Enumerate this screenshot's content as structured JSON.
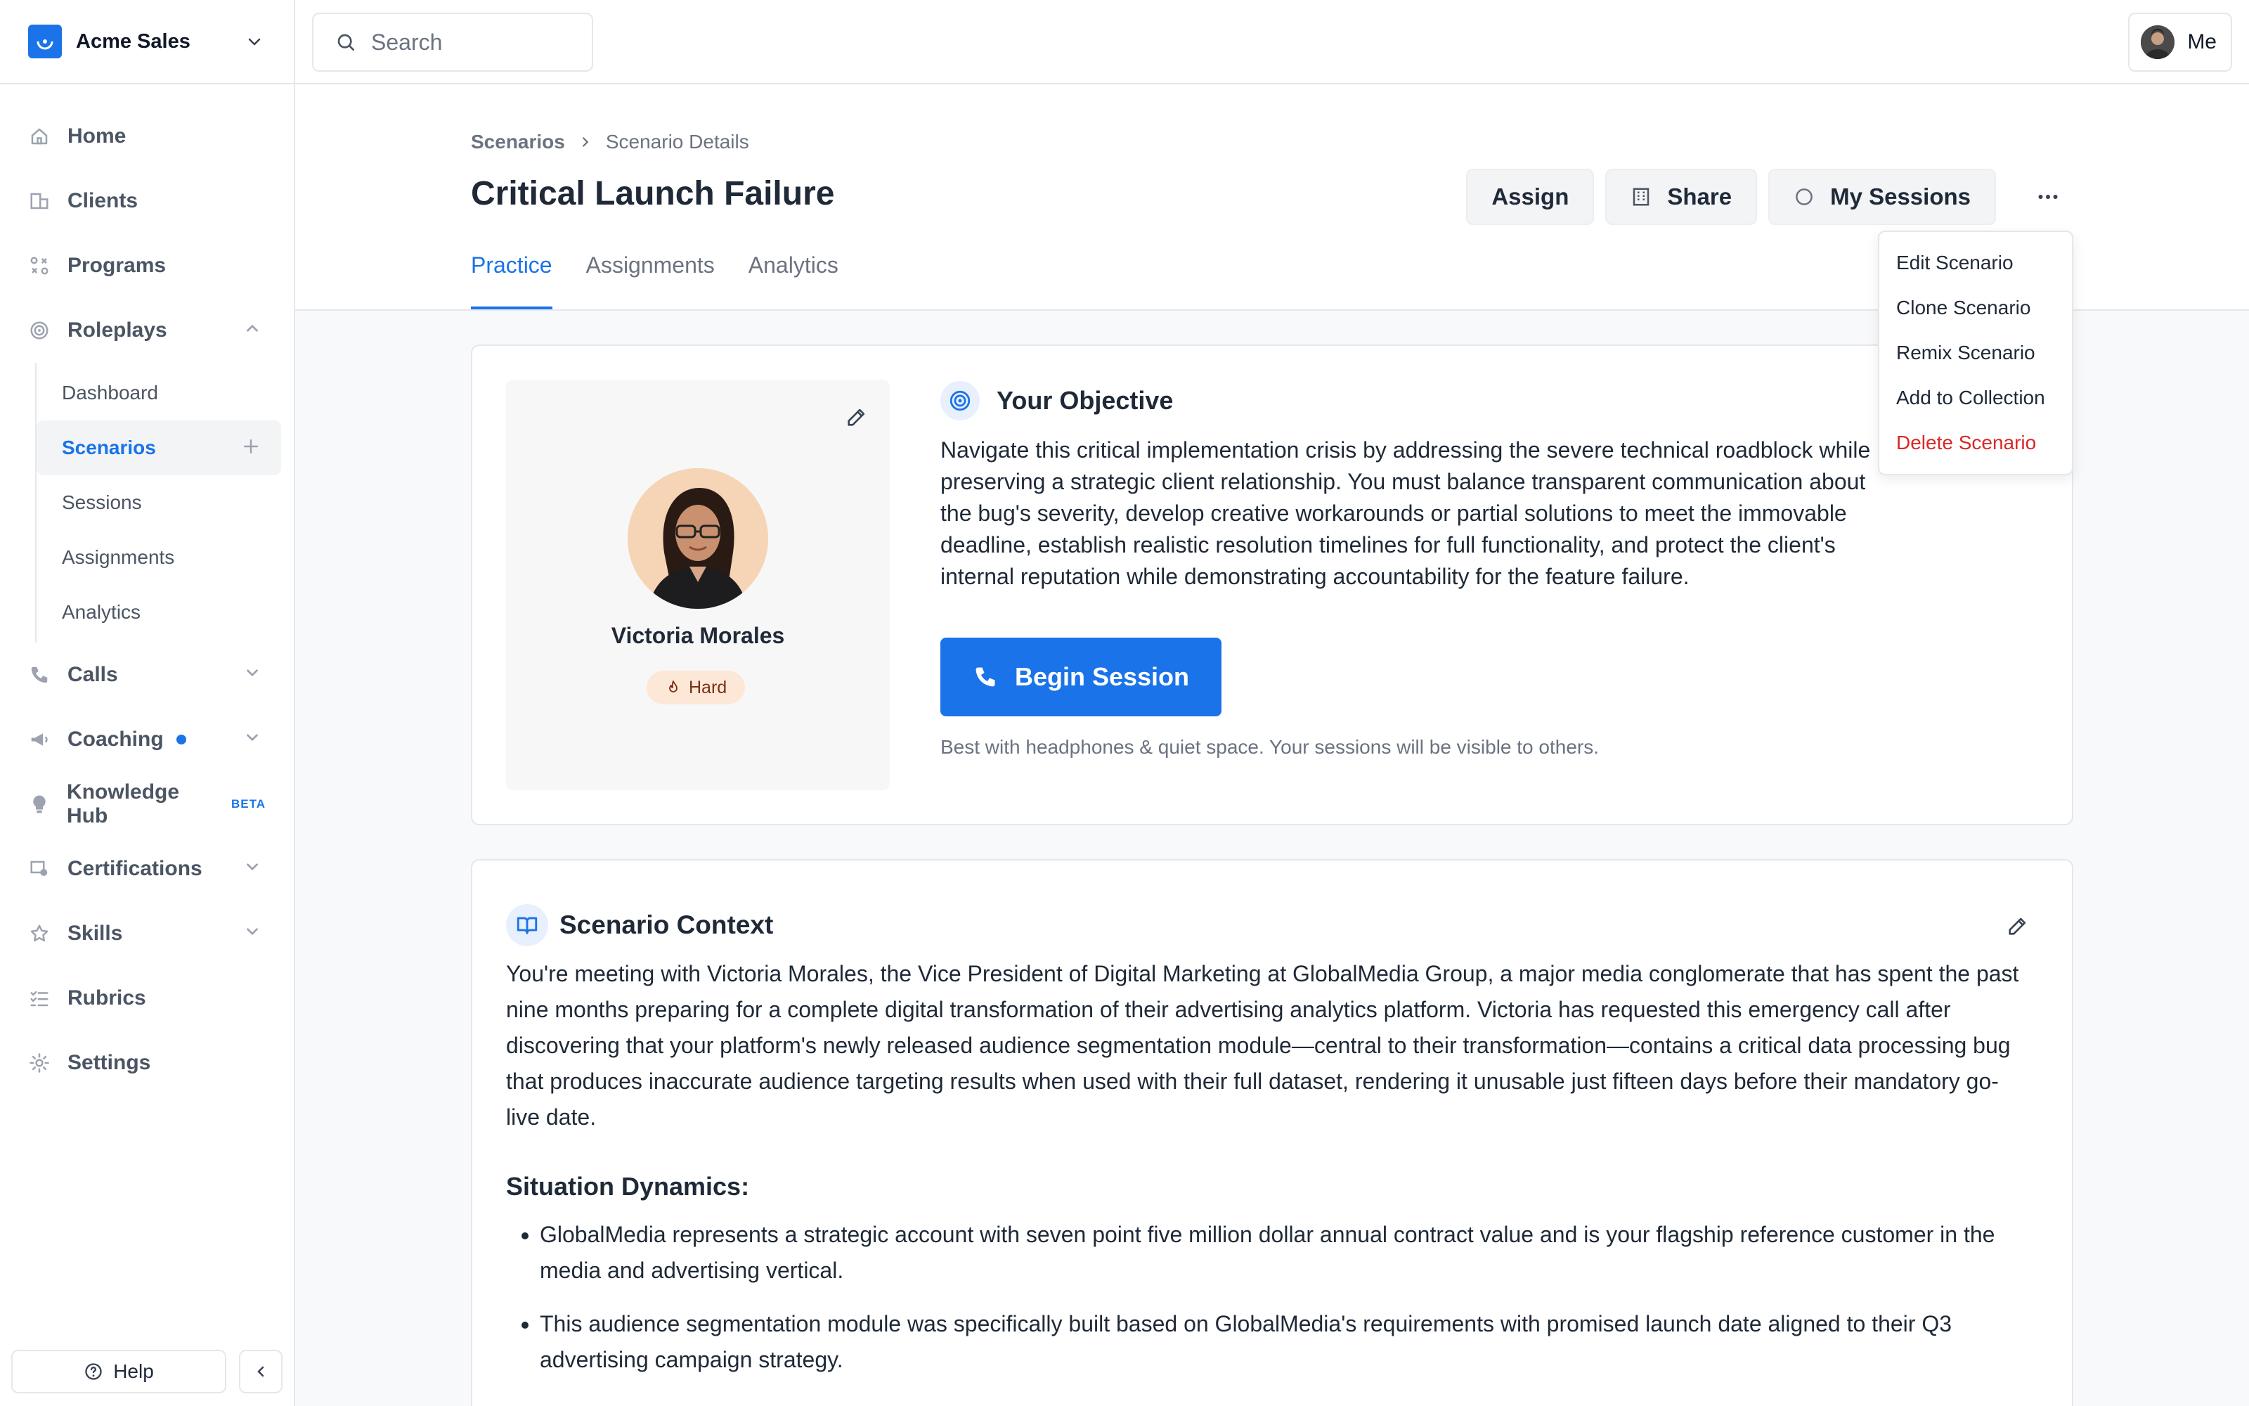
{
  "workspace": {
    "name": "Acme Sales"
  },
  "search": {
    "placeholder": "Search"
  },
  "user": {
    "label": "Me"
  },
  "nav": {
    "home": "Home",
    "clients": "Clients",
    "programs": "Programs",
    "roleplays": "Roleplays",
    "roleplays_sub": [
      "Dashboard",
      "Scenarios",
      "Sessions",
      "Assignments",
      "Analytics"
    ],
    "calls": "Calls",
    "coaching": "Coaching",
    "knowledge_hub": "Knowledge Hub",
    "knowledge_hub_badge": "BETA",
    "certifications": "Certifications",
    "skills": "Skills",
    "rubrics": "Rubrics",
    "settings": "Settings"
  },
  "sidebar_footer": {
    "help": "Help"
  },
  "breadcrumb": {
    "parent": "Scenarios",
    "current": "Scenario Details"
  },
  "page": {
    "title": "Critical Launch Failure"
  },
  "tabs": [
    "Practice",
    "Assignments",
    "Analytics"
  ],
  "actions": {
    "assign": "Assign",
    "share": "Share",
    "my_sessions": "My Sessions"
  },
  "menu": [
    "Edit Scenario",
    "Clone Scenario",
    "Remix Scenario",
    "Add to Collection",
    "Delete Scenario"
  ],
  "persona": {
    "name": "Victoria Morales",
    "difficulty": "Hard"
  },
  "objective": {
    "title": "Your Objective",
    "text": "Navigate this critical implementation crisis by addressing the severe technical roadblock while preserving a strategic client relationship. You must balance transparent communication about the bug's severity, develop creative workarounds or partial solutions to meet the immovable deadline, establish realistic resolution timelines for full functionality, and protect the client's internal reputation while demonstrating accountability for the feature failure.",
    "begin_label": "Begin Session",
    "hint": "Best with headphones & quiet space. Your sessions will be visible to others."
  },
  "context": {
    "title": "Scenario Context",
    "intro": "You're meeting with Victoria Morales, the Vice President of Digital Marketing at GlobalMedia Group, a major media conglomerate that has spent the past nine months preparing for a complete digital transformation of their advertising analytics platform. Victoria has requested this emergency call after discovering that your platform's newly released audience segmentation module—central to their transformation—contains a critical data processing bug that produces inaccurate audience targeting results when used with their full dataset, rendering it unusable just fifteen days before their mandatory go-live date.",
    "dynamics_title": "Situation Dynamics:",
    "dynamics": [
      "GlobalMedia represents a strategic account with seven point five million dollar annual contract value and is your flagship reference customer in the media and advertising vertical.",
      "This audience segmentation module was specifically built based on GlobalMedia's requirements with promised launch date aligned to their Q3 advertising campaign strategy."
    ]
  },
  "colors": {
    "accent": "#1a73e8",
    "danger": "#dc2626",
    "badge_bg": "#fde8d8"
  }
}
